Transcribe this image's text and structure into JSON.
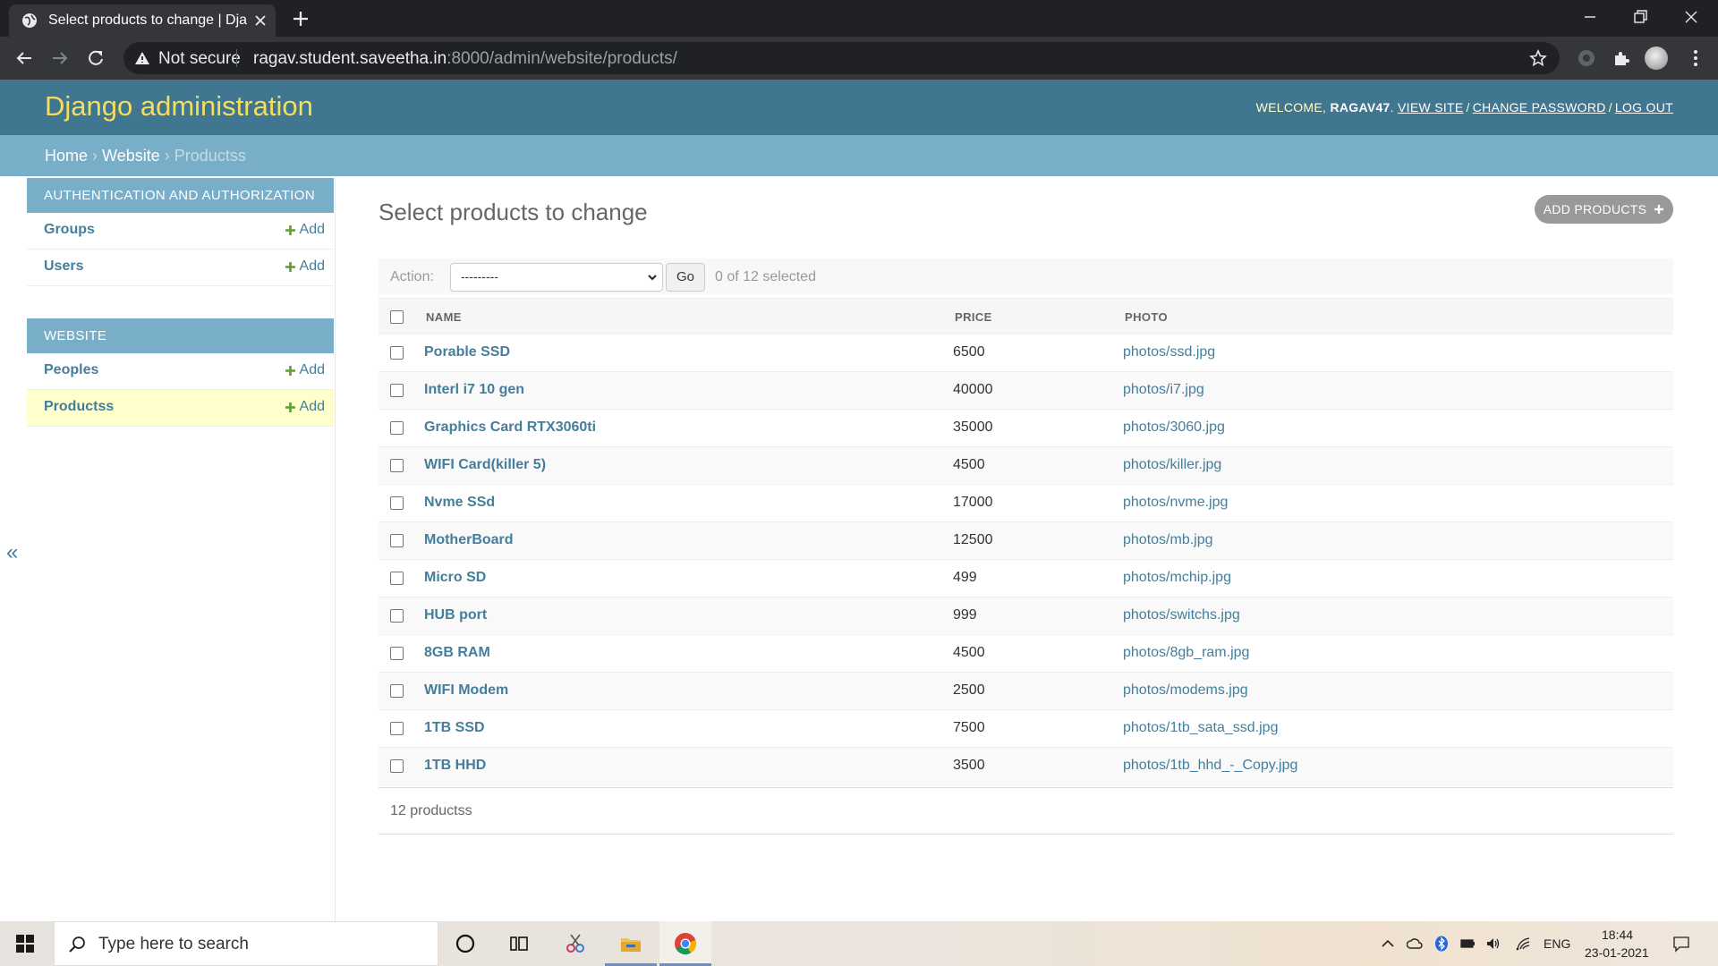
{
  "browser": {
    "tab_title": "Select products to change | Django site admin",
    "not_secure": "Not secure",
    "url_host": "ragav.student.saveetha.in",
    "url_rest": ":8000/admin/website/products/"
  },
  "header": {
    "branding": "Django administration",
    "welcome": "WELCOME,",
    "username": "RAGAV47",
    "dot": ".",
    "view_site": "VIEW SITE",
    "change_password": "CHANGE PASSWORD",
    "log_out": "LOG OUT",
    "sep": "/"
  },
  "breadcrumbs": {
    "home": "Home",
    "app": "Website",
    "current": "Productss",
    "sep": "›"
  },
  "sidebar": {
    "toggle": "«",
    "add_label": "Add",
    "modules": [
      {
        "caption": "AUTHENTICATION AND AUTHORIZATION",
        "models": [
          {
            "name": "Groups"
          },
          {
            "name": "Users"
          }
        ]
      },
      {
        "caption": "WEBSITE",
        "models": [
          {
            "name": "Peoples"
          },
          {
            "name": "Productss"
          }
        ]
      }
    ]
  },
  "content": {
    "title": "Select products to change",
    "add_button": "ADD PRODUCTS",
    "action_label": "Action:",
    "action_selected": "---------",
    "go": "Go",
    "selected_count": "0 of 12 selected",
    "columns": {
      "name": "NAME",
      "price": "PRICE",
      "photo": "PHOTO"
    },
    "rows": [
      {
        "name": "Porable SSD",
        "price": "6500",
        "photo": "photos/ssd.jpg"
      },
      {
        "name": "Interl i7 10 gen",
        "price": "40000",
        "photo": "photos/i7.jpg"
      },
      {
        "name": "Graphics Card RTX3060ti",
        "price": "35000",
        "photo": "photos/3060.jpg"
      },
      {
        "name": "WIFI Card(killer 5)",
        "price": "4500",
        "photo": "photos/killer.jpg"
      },
      {
        "name": "Nvme SSd",
        "price": "17000",
        "photo": "photos/nvme.jpg"
      },
      {
        "name": "MotherBoard",
        "price": "12500",
        "photo": "photos/mb.jpg"
      },
      {
        "name": "Micro SD",
        "price": "499",
        "photo": "photos/mchip.jpg"
      },
      {
        "name": "HUB port",
        "price": "999",
        "photo": "photos/switchs.jpg"
      },
      {
        "name": "8GB RAM",
        "price": "4500",
        "photo": "photos/8gb_ram.jpg"
      },
      {
        "name": "WIFI Modem",
        "price": "2500",
        "photo": "photos/modems.jpg"
      },
      {
        "name": "1TB SSD",
        "price": "7500",
        "photo": "photos/1tb_sata_ssd.jpg"
      },
      {
        "name": "1TB HHD",
        "price": "3500",
        "photo": "photos/1tb_hhd_-_Copy.jpg"
      }
    ],
    "paginator": "12 productss"
  },
  "taskbar": {
    "search_placeholder": "Type here to search",
    "lang": "ENG",
    "time": "18:44",
    "date": "23-01-2021"
  },
  "colors": {
    "header": "#417690",
    "breadcrumbs": "#79aec8",
    "branding": "#f5dd5d",
    "link": "#447e9b",
    "current_model_bg": "#ffffcc"
  }
}
